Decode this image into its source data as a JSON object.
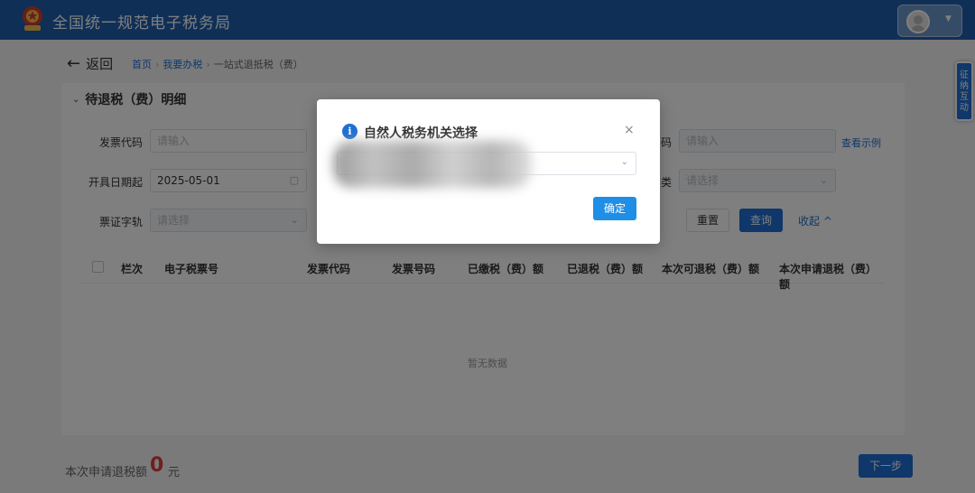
{
  "header": {
    "title": "全国统一规范电子税务局"
  },
  "side_tab": {
    "label": "征纳互动"
  },
  "breadcrumb": {
    "back_label": "返回",
    "items": [
      "首页",
      "我要办税",
      "一站式退抵税（费）"
    ]
  },
  "section": {
    "title": "待退税（费）明细"
  },
  "form": {
    "invoice_code_label": "发票代码",
    "invoice_code_placeholder": "请输入",
    "invoice_number_label_partial": "码",
    "invoice_number_placeholder": "请输入",
    "view_example": "查看示例",
    "start_date_label": "开具日期起",
    "start_date_value": "2025-05-01",
    "type_label_partial": "类",
    "type_placeholder": "请选择",
    "ticket_track_label": "票证字轨",
    "ticket_track_placeholder": "请选择",
    "reset_label": "重置",
    "query_label": "查询",
    "collapse_label": "收起"
  },
  "table": {
    "columns": [
      "栏次",
      "电子税票号",
      "发票代码",
      "发票号码",
      "已缴税（费）额",
      "已退税（费）额",
      "本次可退税（费）额",
      "本次申请退税（费）额"
    ],
    "empty_text": "暂无数据"
  },
  "footer": {
    "label": "本次申请退税额",
    "amount": "0",
    "unit": "元",
    "next_label": "下一步"
  },
  "dialog": {
    "title": "自然人税务机关选择",
    "close_glyph": "×",
    "confirm_label": "确定"
  },
  "colors": {
    "header_bg": "#1f5fae",
    "primary": "#1f6fd4",
    "amount_red": "#e23c39"
  }
}
